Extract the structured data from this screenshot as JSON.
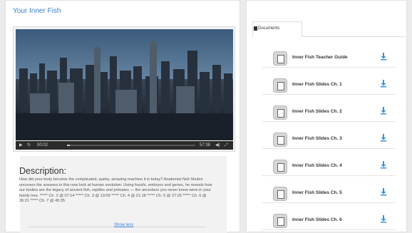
{
  "page": {
    "title": "Your Inner Fish"
  },
  "video": {
    "current_time": "00:02",
    "duration": "57:38",
    "progress_fraction": 0.02
  },
  "description": {
    "heading": "Description:",
    "body": "How did your body become the complicated, quirky, amazing machine it is today? Anatomist Neil Shubin uncovers the answers in this new look at human evolution. Using fossils, embryos and genes, he reveals how our bodies are the legacy of ancient fish, reptiles and primates — the ancestors you never knew were in your family tree. ***** Ch. 2 @ 07:14 ***** Ch. 3 @ 13:09 ***** Ch. 4 @ 21:18 ***** Ch. 5 @ 27:25 ***** Ch. 6 @ 36:21 ***** Ch. 7 @ 45:35",
    "show_less": "Show less"
  },
  "documents": {
    "tab_label": "Documents",
    "items": [
      {
        "label": "Inner Fish Teacher Guide"
      },
      {
        "label": "Inner Fish Slides Ch. 1"
      },
      {
        "label": "Inner Fish Slides Ch. 2"
      },
      {
        "label": "Inner Fish Slides Ch. 3"
      },
      {
        "label": "Inner Fish Slides Ch. 4"
      },
      {
        "label": "Inner Fish Slides Ch. 5"
      },
      {
        "label": "Inner Fish Slides Ch. 6"
      }
    ]
  },
  "colors": {
    "accent": "#3a7fd0",
    "download": "#3a8fd8"
  }
}
